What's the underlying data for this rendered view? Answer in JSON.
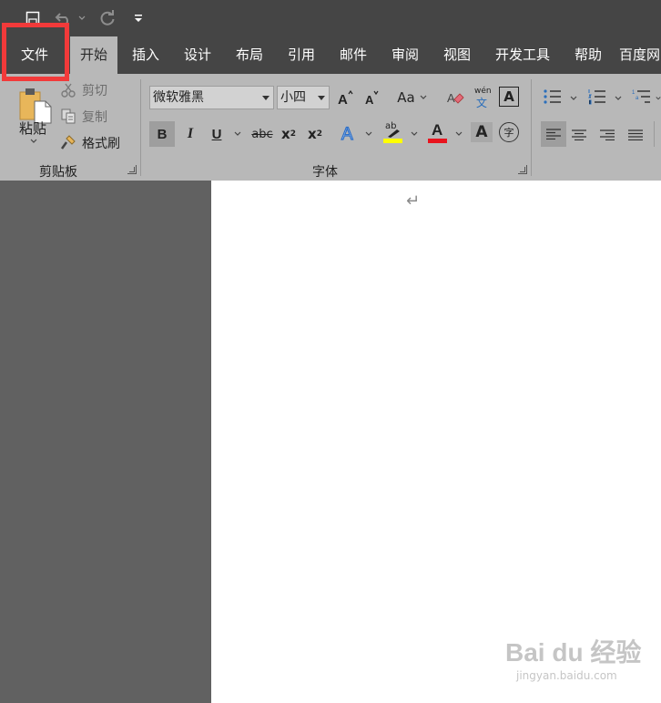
{
  "tabs": [
    {
      "label": "文件"
    },
    {
      "label": "开始"
    },
    {
      "label": "插入"
    },
    {
      "label": "设计"
    },
    {
      "label": "布局"
    },
    {
      "label": "引用"
    },
    {
      "label": "邮件"
    },
    {
      "label": "审阅"
    },
    {
      "label": "视图"
    },
    {
      "label": "开发工具"
    },
    {
      "label": "帮助"
    },
    {
      "label": "百度网"
    }
  ],
  "active_tab": "开始",
  "clipboard": {
    "paste_label": "粘贴",
    "cut_label": "剪切",
    "copy_label": "复制",
    "format_painter_label": "格式刷",
    "group_label": "剪贴板"
  },
  "font": {
    "font_name": "微软雅黑",
    "font_size": "小四",
    "change_case_label": "Aa",
    "phonetic_top": "wén",
    "phonetic_bottom": "文",
    "char_border_label": "A",
    "bold_label": "B",
    "italic_label": "I",
    "underline_label": "U",
    "strikethrough_label": "abc",
    "subscript_base": "x",
    "subscript_mark": "2",
    "superscript_base": "x",
    "superscript_mark": "2",
    "highlight_label": "ab",
    "font_color_label": "A",
    "char_shading_label": "A",
    "enclose_label": "字",
    "group_label": "字体"
  },
  "colors": {
    "highlight_color": "#ffff00",
    "font_color": "#e8141e",
    "annotation_box": "#f23a3a"
  },
  "document": {
    "paragraph_mark": "↵"
  },
  "watermark": {
    "brand": "Bai du 经验",
    "url": "jingyan.baidu.com"
  }
}
